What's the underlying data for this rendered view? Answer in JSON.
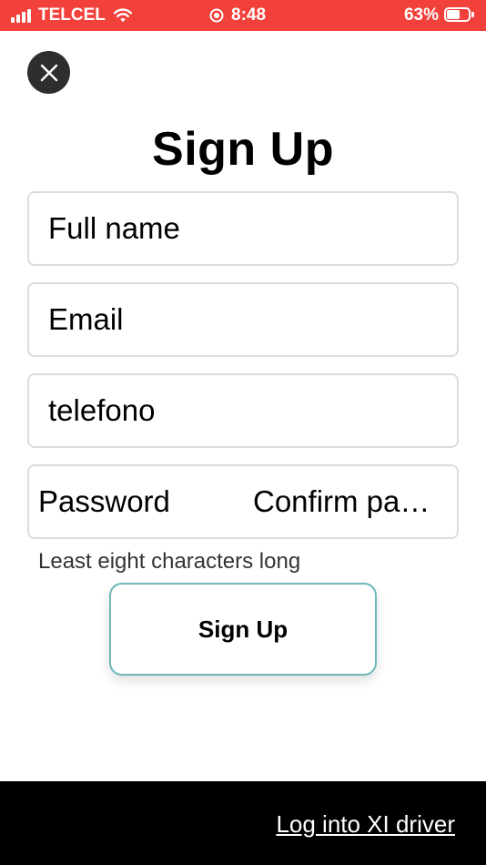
{
  "status_bar": {
    "carrier": "TELCEL",
    "time": "8:48",
    "battery_percent": "63%",
    "battery_level": 0.63,
    "icons": [
      "signal-icon",
      "wifi-icon",
      "location-icon",
      "battery-icon"
    ],
    "background_color": "#f2403a"
  },
  "close_button": {
    "icon": "close-icon"
  },
  "page_title": "Sign Up",
  "form": {
    "full_name_placeholder": "Full name",
    "email_placeholder": "Email",
    "phone_placeholder": "telefono",
    "password_placeholder": "Password",
    "confirm_password_placeholder": "Confirm pa…",
    "password_hint": "Least eight characters long",
    "submit_label": "Sign Up",
    "submit_border_color": "#6fb7b8"
  },
  "footer": {
    "login_link": "Log into XI driver",
    "background_color": "#000000"
  }
}
